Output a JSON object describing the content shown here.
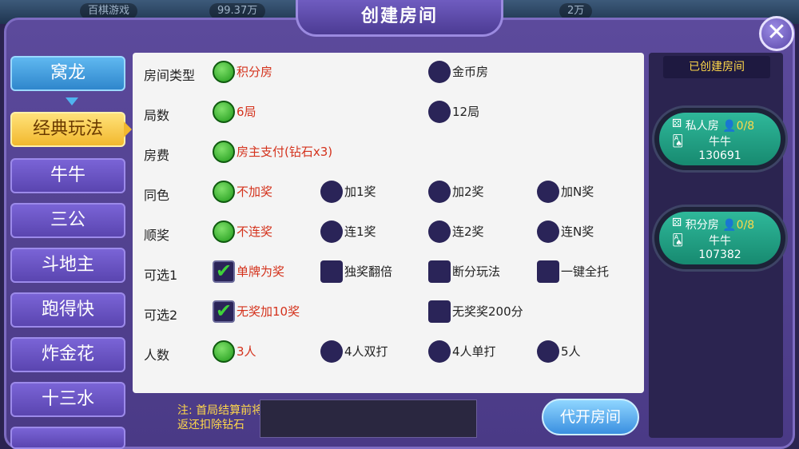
{
  "background": {
    "items": [
      "百棋游戏",
      "99.37万",
      "2万"
    ]
  },
  "dialog": {
    "title": "创建房间",
    "close_icon": "close-icon"
  },
  "nav": {
    "items": [
      {
        "label": "窝龙",
        "state": "top"
      },
      {
        "label": "经典玩法",
        "state": "active"
      },
      {
        "label": "牛牛"
      },
      {
        "label": "三公"
      },
      {
        "label": "斗地主"
      },
      {
        "label": "跑得快"
      },
      {
        "label": "炸金花"
      },
      {
        "label": "十三水"
      }
    ]
  },
  "form": {
    "rows": [
      {
        "label": "房间类型",
        "options": [
          "积分房",
          "金币房"
        ]
      },
      {
        "label": "局数",
        "options": [
          "6局",
          "12局"
        ]
      },
      {
        "label": "房费",
        "options": [
          "房主支付(钻石x3)"
        ]
      },
      {
        "label": "同色",
        "options": [
          "不加奖",
          "加1奖",
          "加2奖",
          "加N奖"
        ]
      },
      {
        "label": "顺奖",
        "options": [
          "不连奖",
          "连1奖",
          "连2奖",
          "连N奖"
        ]
      },
      {
        "label": "可选1",
        "options": [
          "单牌为奖",
          "独奖翻倍",
          "断分玩法",
          "一键全托"
        ]
      },
      {
        "label": "可选2",
        "options": [
          "无奖加10奖",
          "无奖奖200分"
        ]
      },
      {
        "label": "人数",
        "options": [
          "3人",
          "4人双打",
          "4人单打",
          "5人"
        ]
      }
    ]
  },
  "footer": {
    "note_line1": "注: 首局结算前将",
    "note_line2": "返还扣除钻石",
    "open_button": "代开房间"
  },
  "rooms": {
    "title": "已创建房间",
    "list": [
      {
        "type": "私人房",
        "count": "0/8",
        "game": "牛牛",
        "id": "130691"
      },
      {
        "type": "积分房",
        "count": "0/8",
        "game": "牛牛",
        "id": "107382"
      }
    ]
  },
  "colors": {
    "selected_text": "#d4321c",
    "accent_gold": "#ffd84a",
    "dialog_purple": "#5c4a9c"
  }
}
